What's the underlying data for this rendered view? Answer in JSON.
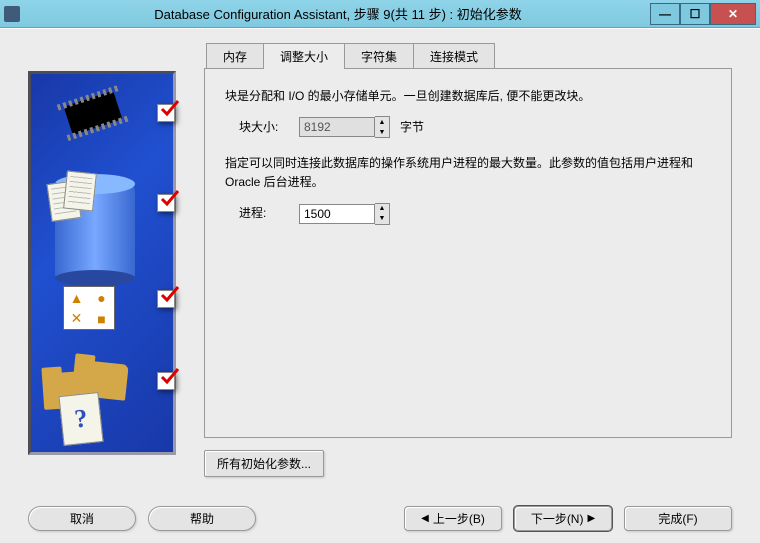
{
  "window": {
    "title": "Database Configuration Assistant, 步骤 9(共 11 步) : 初始化参数"
  },
  "tabs": {
    "memory": "内存",
    "sizing": "调整大小",
    "charset": "字符集",
    "connmode": "连接模式"
  },
  "sizing": {
    "block_desc": "块是分配和 I/O 的最小存储单元。一旦创建数据库后, 便不能更改块。",
    "block_label": "块大小:",
    "block_value": "8192",
    "block_unit": "字节",
    "process_desc": "指定可以同时连接此数据库的操作系统用户进程的最大数量。此参数的值包括用户进程和 Oracle 后台进程。",
    "process_label": "进程:",
    "process_value": "1500"
  },
  "buttons": {
    "all_params": "所有初始化参数...",
    "cancel": "取消",
    "help": "帮助",
    "back": "上一步(B)",
    "next": "下一步(N)",
    "finish": "完成(F)"
  }
}
